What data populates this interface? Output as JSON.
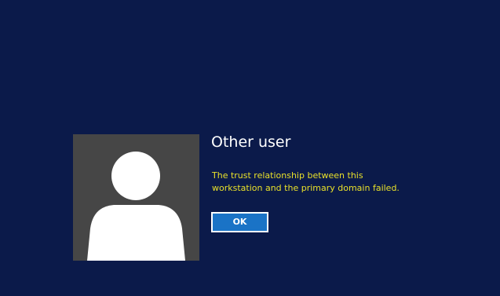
{
  "login": {
    "user_name": "Other user",
    "avatar_icon": "user-silhouette-icon",
    "error_message": "The trust relationship between this workstation and the primary domain failed.",
    "ok_label": "OK"
  },
  "colors": {
    "background": "#0b1a4a",
    "avatar_tile": "#464646",
    "message_text": "#e8e02a",
    "button_fill": "#1a73c6"
  }
}
